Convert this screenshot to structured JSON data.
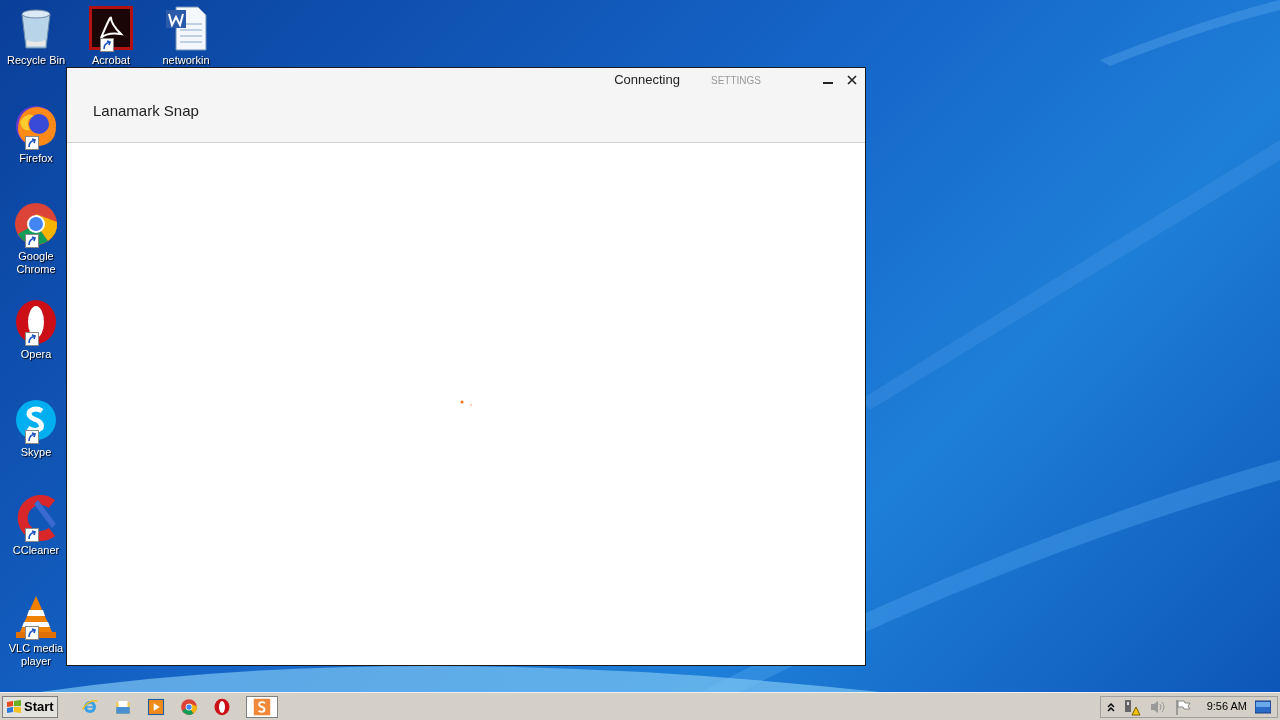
{
  "desktop_icons": [
    {
      "kind": "recycle",
      "label": "Recycle Bin",
      "shortcut": false
    },
    {
      "kind": "acrobat",
      "label": "Acrobat",
      "shortcut": true
    },
    {
      "kind": "word",
      "label": "networkin",
      "shortcut": false
    },
    {
      "kind": "firefox",
      "label": "Firefox",
      "shortcut": true
    },
    {
      "kind": "chrome",
      "label": "Google Chrome",
      "shortcut": true
    },
    {
      "kind": "opera",
      "label": "Opera",
      "shortcut": true
    },
    {
      "kind": "skype",
      "label": "Skype",
      "shortcut": true
    },
    {
      "kind": "ccleaner",
      "label": "CCleaner",
      "shortcut": true
    },
    {
      "kind": "vlc",
      "label": "VLC media player",
      "shortcut": true
    }
  ],
  "window": {
    "title": "Lanamark Snap",
    "status": "Connecting",
    "settings": "SETTINGS"
  },
  "taskbar": {
    "start": "Start",
    "pinned": [
      {
        "kind": "ie"
      },
      {
        "kind": "explorer"
      },
      {
        "kind": "media"
      },
      {
        "kind": "chrome"
      },
      {
        "kind": "opera"
      }
    ],
    "running": [
      {
        "kind": "snap",
        "selected": true
      }
    ],
    "clock": "9:56 AM"
  }
}
